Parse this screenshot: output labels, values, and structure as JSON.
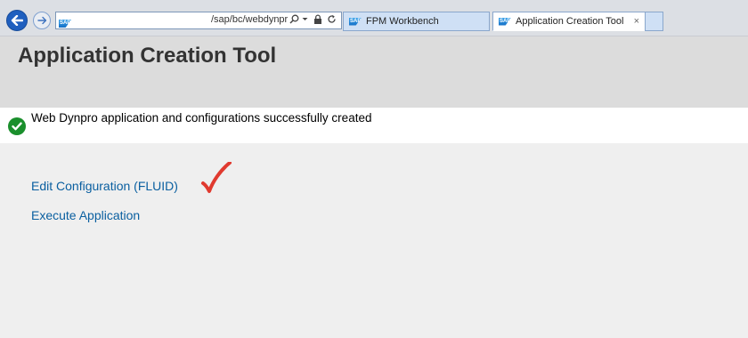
{
  "browser": {
    "address_url": "/sap/bc/webdynpro",
    "tabs": [
      {
        "label": "FPM Workbench",
        "active": false
      },
      {
        "label": "Application Creation Tool",
        "active": true
      }
    ],
    "close_tab_glyph": "×"
  },
  "page": {
    "title": "Application Creation Tool"
  },
  "message": {
    "type": "success",
    "icon": "check-circle-icon",
    "text": "Web Dynpro application and configurations successfully created"
  },
  "links": [
    {
      "label": "Edit Configuration (FLUID)"
    },
    {
      "label": "Execute Application"
    }
  ],
  "annotation": {
    "icon": "red-check-mark",
    "color": "#e03a2f"
  },
  "colors": {
    "header_bg": "#dcdcdc",
    "page_bg": "#efefef",
    "link": "#0a5fa0",
    "success": "#1a8f2c"
  }
}
